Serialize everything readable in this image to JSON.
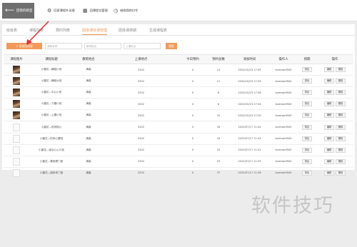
{
  "toolbar": {
    "back_label": "回我的教室",
    "items": [
      {
        "label": "回家课程外访理",
        "icon": "gear-icon"
      },
      {
        "label": "回课程位管理",
        "icon": "grid-icon"
      },
      {
        "label": "修改我的口令",
        "icon": "clock-icon"
      }
    ]
  },
  "tabs": [
    {
      "label": "班级表",
      "active": false
    },
    {
      "label": "课程列表",
      "active": false
    },
    {
      "label": "预约列表",
      "active": false
    },
    {
      "label": "团体课体课管理",
      "active": true
    },
    {
      "label": "团体课排期",
      "active": false
    },
    {
      "label": "生成课程表",
      "active": false
    }
  ],
  "filters": {
    "add_label": "+ 添加团体课",
    "course_placeholder": "课程名称",
    "teacher_placeholder": "教师姓名",
    "location_placeholder": "上课地点",
    "search_label": "搜索"
  },
  "table": {
    "headers": [
      "课程图片",
      "课程标题",
      "教练姓名",
      "上课地点",
      "今日预约",
      "预约总数",
      "添加时间",
      "操作人",
      "排期",
      "操作"
    ],
    "rows": [
      {
        "image": "photo",
        "title": "小董花—舞蹈小班",
        "coach": "满森",
        "location": "3202",
        "today": "0",
        "total": "14",
        "time": "2020/10/23 17:45",
        "operator": "loverwell940"
      },
      {
        "image": "photo",
        "title": "小董花—舞蹈大班",
        "coach": "满森",
        "location": "3202",
        "today": "0",
        "total": "11",
        "time": "2020/10/23 17:39",
        "operator": "loverwell940"
      },
      {
        "image": "photo",
        "title": "小董花—中心小班",
        "coach": "满森",
        "location": "3202",
        "today": "0",
        "total": "6",
        "time": "2020/10/23 17:36",
        "operator": "loverwell940"
      },
      {
        "image": "photo",
        "title": "小董花—下腰小班",
        "coach": "满森",
        "location": "3202",
        "today": "0",
        "total": "6",
        "time": "2020/10/23 17:34",
        "operator": "loverwell940"
      },
      {
        "image": "photo",
        "title": "小董花—上腰小班",
        "coach": "满森",
        "location": "3202",
        "today": "0",
        "total": "10",
        "time": "2020/10/23 17:30",
        "operator": "loverwell940"
      },
      {
        "image": "blank",
        "title": "小董花—前排核心",
        "coach": "满森",
        "location": "3202",
        "today": "0",
        "total": "16",
        "time": "2020/07/17 11:44",
        "operator": "loverwell940"
      },
      {
        "image": "blank",
        "title": "小董花—形体心腰班",
        "coach": "满森",
        "location": "3202",
        "today": "0",
        "total": "16",
        "time": "2020/07/17 11:43",
        "operator": "loverwell940"
      },
      {
        "image": "blank",
        "title": "小董花—组合心心口造",
        "coach": "满森",
        "location": "3202",
        "today": "0",
        "total": "25",
        "time": "2020/07/17 11:41",
        "operator": "loverwell940"
      },
      {
        "image": "blank",
        "title": "小董花—基础理门造",
        "coach": "满森",
        "location": "3202",
        "today": "0",
        "total": "23",
        "time": "2020/07/17 11:39",
        "operator": "loverwell940"
      },
      {
        "image": "blank",
        "title": "小董花—团体体门造",
        "coach": "满森",
        "location": "3202",
        "today": "0",
        "total": "37",
        "time": "2020/07/17 11:38",
        "operator": "loverwell940"
      }
    ],
    "schedule_label": "排出",
    "edit_label": "编辑",
    "delete_label": "删除"
  },
  "watermark": "软件技巧",
  "annotation_color": "#e0313b",
  "accent_color": "#f39a5a"
}
